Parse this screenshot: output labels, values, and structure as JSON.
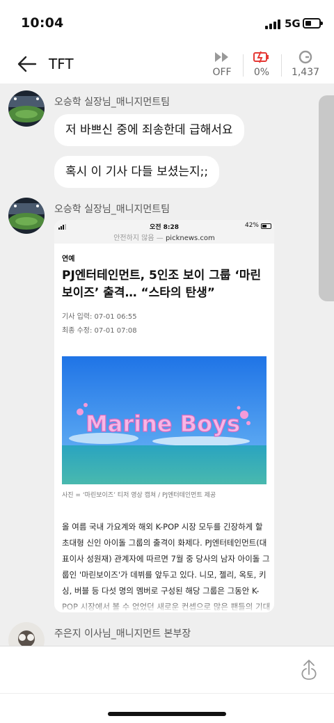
{
  "status_bar": {
    "time": "10:04",
    "network": "5G"
  },
  "header": {
    "back_icon": "arrow-left-icon",
    "title": "TFT",
    "stats": [
      {
        "icon": "fast-forward-icon",
        "value": "OFF"
      },
      {
        "icon": "battery-alert-icon",
        "value": "0%",
        "color": "#e53935"
      },
      {
        "icon": "g-circle-icon",
        "value": "1,437"
      }
    ]
  },
  "messages": [
    {
      "sender": "오승학 실장님_매니지먼트팀",
      "bubbles": [
        "저 바쁘신 중에 죄송한데 급해서요",
        "혹시 이 기사 다들 보셨는지;;"
      ]
    },
    {
      "sender": "오승학 실장님_매니지먼트팀"
    },
    {
      "sender": "주은지 이사님_매니지먼트 본부장"
    }
  ],
  "article": {
    "browser": {
      "time": "오전 8:28",
      "battery": "42%",
      "unsafe": "안전하지 않음",
      "separator": "—",
      "domain": "picknews.com"
    },
    "section": "연예",
    "headline": "PJ엔터테인먼트, 5인조 보이 그룹 ‘마린보이즈’ 출격… “스타의 탄생”",
    "published": "기사 입력: 07-01 06:55",
    "updated": "최종 수정: 07-01 07:08",
    "image_text": "Marine Boys",
    "caption": "사진 = ‘마린보이즈’ 티저 영상 캡쳐 / PJ엔터테인먼트 제공",
    "body": "올 여름 국내 가요계와 해외 K-POP 시장 모두를 긴장하게 할 초대형 신인 아이돌 그룹의 출격이 화제다. PJ엔터테인먼트(대표이사 성원재) 관계자에 따르면 7월 중 당사의 남자 아이돌 그룹인 '마린보이즈'가 데뷔를 앞두고 있다. 니모, 젤리, 옥토, 키싱, 버블 등 다섯 명의 멤버로 구성된 해당 그룹은 그동안 K-POP 시장에서 볼 수 없었던 새로운 컨셉으로 많은 팬들의 기대를 모으고 있다. 공개된 티저 영상에서는 멤버들"
  },
  "colors": {
    "chat_bg": "#efefef",
    "alert": "#e53935"
  }
}
